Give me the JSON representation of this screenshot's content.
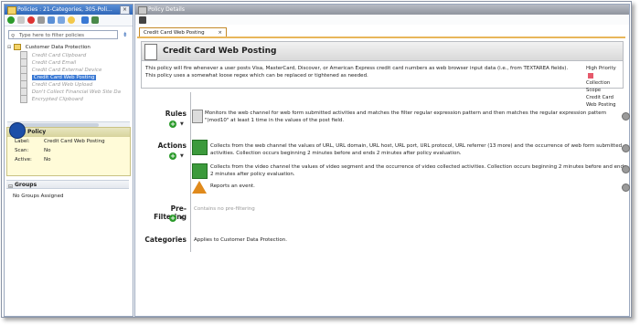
{
  "left_pane": {
    "title": "Policies : 21-Categories, 305-Poli...",
    "filter_placeholder": "Type here to filter policies",
    "tree": {
      "root": "Customer Data Protection",
      "items": [
        {
          "label": "Credit Card Clipboard",
          "state": "disabled"
        },
        {
          "label": "Credit Card Email",
          "state": "disabled"
        },
        {
          "label": "Credit Card External Device",
          "state": "disabled"
        },
        {
          "label": "Credit Card Web Posting",
          "state": "selected"
        },
        {
          "label": "Credit Card Web Upload",
          "state": "disabled"
        },
        {
          "label": "Don't Collect Financial Web Site Da",
          "state": "disabled"
        },
        {
          "label": "Encrypted Clipboard",
          "state": "disabled"
        }
      ]
    },
    "policy_panel": {
      "title": "Policy",
      "label_key": "Label:",
      "label_value": "Credit Card Web Posting",
      "scan_key": "Scan:",
      "scan_value": "No",
      "active_key": "Active:",
      "active_value": "No"
    },
    "groups": {
      "title": "Groups",
      "value": "No Groups Assigned"
    }
  },
  "right_pane": {
    "title": "Policy Details",
    "tab_label": "Credit Card Web Posting",
    "tab_close": "×",
    "header_title": "Credit Card Web Posting",
    "description": "This policy will fire whenever a user posts Visa, MasterCard, Discover, or American Express credit card numbers as web browser input data (i.e., from TEXTAREA fields). This policy uses a somewhat loose regex which can be replaced or tightened as needed.",
    "priority": "High Priority",
    "collection_scope": "Collection Scope",
    "scope_value": "Credit Card Web Posting",
    "rules_label": "Rules",
    "actions_label": "Actions",
    "prefiltering_label": "Pre-Filtering",
    "categories_label": "Categories",
    "rule_text": "Monitors the web channel for web form submitted activities and matches the filter regular expression pattern and then matches the regular expression pattern \")mod10\" at least 1 time in the values of the post field.",
    "action1_text": "Collects from the web channel the values of URL, URL domain, URL host, URL port, URL protocol, URL referrer (13 more) and the occurrence of web form submitted activities. Collection occurs beginning 2 minutes before and ends 2 minutes after policy evaluation.",
    "action2_text": "Collects from the video channel the values of video segment and the occurrence of video collected activities. Collection occurs beginning 2 minutes before and ends 2 minutes after policy evaluation.",
    "action3_text": "Reports an event.",
    "prefilter_text": "Contains no pre-filtering",
    "categories_text": "Applies to Customer Data Protection."
  },
  "colors": {
    "accent": "#3a79d4",
    "priority_high": "#e6596b",
    "tab_border": "#c48a2a"
  }
}
